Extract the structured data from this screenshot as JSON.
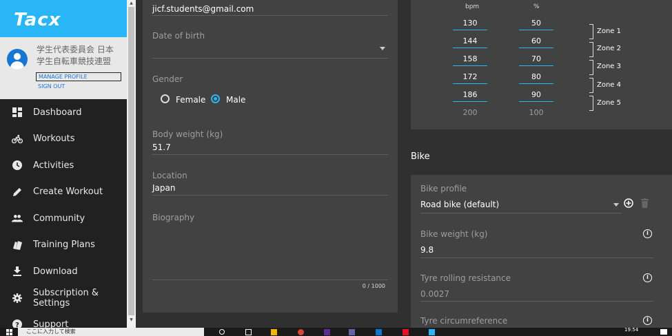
{
  "brand": {
    "name": "Tacx"
  },
  "profile": {
    "name_line1": "学生代表委員会 日本",
    "name_line2": "学生自転車競技連盟",
    "manage_label": "MANAGE PROFILE",
    "signout_label": "SIGN OUT"
  },
  "nav": {
    "items": [
      {
        "label": "Dashboard",
        "icon": "dashboard-icon"
      },
      {
        "label": "Workouts",
        "icon": "bike-icon"
      },
      {
        "label": "Activities",
        "icon": "clock-icon"
      },
      {
        "label": "Create Workout",
        "icon": "pencil-icon"
      },
      {
        "label": "Community",
        "icon": "people-icon"
      },
      {
        "label": "Training Plans",
        "icon": "cards-icon"
      },
      {
        "label": "Download",
        "icon": "download-icon"
      },
      {
        "label": "Subscription & Settings",
        "icon": "gear-icon"
      },
      {
        "label": "Support",
        "icon": "help-icon"
      }
    ]
  },
  "form": {
    "email": "jicf.students@gmail.com",
    "dob_label": "Date of birth",
    "dob_value": "",
    "gender_label": "Gender",
    "gender_options": [
      "Female",
      "Male"
    ],
    "gender_selected": "Male",
    "weight_label": "Body weight (kg)",
    "weight_value": "51.7",
    "location_label": "Location",
    "location_value": "Japan",
    "bio_label": "Biography",
    "bio_value": "",
    "bio_counter": "0 / 1000"
  },
  "heart_rate": {
    "col_bpm": "bpm",
    "col_pct": "%",
    "bpm": [
      "130",
      "144",
      "158",
      "172",
      "186"
    ],
    "pct": [
      "50",
      "60",
      "70",
      "80",
      "90"
    ],
    "max_bpm": "200",
    "max_pct": "100",
    "zones": [
      "Zone 1",
      "Zone 2",
      "Zone 3",
      "Zone 4",
      "Zone 5"
    ]
  },
  "bike": {
    "section_title": "Bike",
    "profile_label": "Bike profile",
    "profile_value": "Road bike (default)",
    "weight_label": "Bike weight (kg)",
    "weight_value": "9.8",
    "rolling_label": "Tyre rolling resistance",
    "rolling_value": "0.0027",
    "circ_label": "Tyre circumreference"
  },
  "taskbar": {
    "search_placeholder": "ここに入力して検索",
    "time": "19:54"
  },
  "colors": {
    "accent": "#29b6f6",
    "sidebar": "#212121",
    "card": "#424242",
    "background": "#303030"
  }
}
